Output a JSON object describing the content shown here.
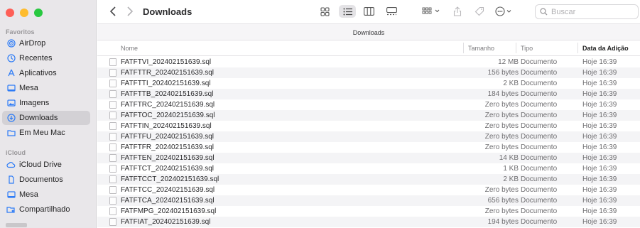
{
  "window": {
    "traffic_colors": {
      "close": "#fe5f57",
      "minimize": "#febc2e",
      "zoom": "#28c840"
    }
  },
  "sidebar": {
    "favorites_title": "Favoritos",
    "favorites": [
      {
        "label": "AirDrop",
        "icon": "airdrop-icon"
      },
      {
        "label": "Recentes",
        "icon": "clock-icon"
      },
      {
        "label": "Aplicativos",
        "icon": "apps-icon"
      },
      {
        "label": "Mesa",
        "icon": "desktop-icon"
      },
      {
        "label": "Imagens",
        "icon": "photo-icon"
      },
      {
        "label": "Downloads",
        "icon": "download-icon",
        "active": true
      },
      {
        "label": "Em Meu Mac",
        "icon": "folder-icon"
      }
    ],
    "icloud_title": "iCloud",
    "icloud": [
      {
        "label": "iCloud Drive",
        "icon": "cloud-icon"
      },
      {
        "label": "Documentos",
        "icon": "document-icon"
      },
      {
        "label": "Mesa",
        "icon": "desktop-icon"
      },
      {
        "label": "Compartilhado",
        "icon": "shared-folder-icon"
      }
    ]
  },
  "toolbar": {
    "title": "Downloads",
    "search_placeholder": "Buscar",
    "accent": "#2e7cf6"
  },
  "pathbar": {
    "label": "Downloads"
  },
  "columns": {
    "name": "Nome",
    "size": "Tamanho",
    "kind": "Tipo",
    "date": "Data da Adição"
  },
  "files": [
    {
      "name": "FATFTVI_202402151639.sql",
      "size": "12 MB",
      "kind": "Documento",
      "date": "Hoje 16:39"
    },
    {
      "name": "FATFTTR_202402151639.sql",
      "size": "156 bytes",
      "kind": "Documento",
      "date": "Hoje 16:39"
    },
    {
      "name": "FATFTTI_202402151639.sql",
      "size": "2 KB",
      "kind": "Documento",
      "date": "Hoje 16:39"
    },
    {
      "name": "FATFTTB_202402151639.sql",
      "size": "184 bytes",
      "kind": "Documento",
      "date": "Hoje 16:39"
    },
    {
      "name": "FATFTRC_202402151639.sql",
      "size": "Zero bytes",
      "kind": "Documento",
      "date": "Hoje 16:39"
    },
    {
      "name": "FATFTOC_202402151639.sql",
      "size": "Zero bytes",
      "kind": "Documento",
      "date": "Hoje 16:39"
    },
    {
      "name": "FATFTIN_202402151639.sql",
      "size": "Zero bytes",
      "kind": "Documento",
      "date": "Hoje 16:39"
    },
    {
      "name": "FATFTFU_202402151639.sql",
      "size": "Zero bytes",
      "kind": "Documento",
      "date": "Hoje 16:39"
    },
    {
      "name": "FATFTFR_202402151639.sql",
      "size": "Zero bytes",
      "kind": "Documento",
      "date": "Hoje 16:39"
    },
    {
      "name": "FATFTEN_202402151639.sql",
      "size": "14 KB",
      "kind": "Documento",
      "date": "Hoje 16:39"
    },
    {
      "name": "FATFTCT_202402151639.sql",
      "size": "1 KB",
      "kind": "Documento",
      "date": "Hoje 16:39"
    },
    {
      "name": "FATFTCCT_202402151639.sql",
      "size": "2 KB",
      "kind": "Documento",
      "date": "Hoje 16:39"
    },
    {
      "name": "FATFTCC_202402151639.sql",
      "size": "Zero bytes",
      "kind": "Documento",
      "date": "Hoje 16:39"
    },
    {
      "name": "FATFTCA_202402151639.sql",
      "size": "656 bytes",
      "kind": "Documento",
      "date": "Hoje 16:39"
    },
    {
      "name": "FATFMPG_202402151639.sql",
      "size": "Zero bytes",
      "kind": "Documento",
      "date": "Hoje 16:39"
    },
    {
      "name": "FATFIAT_202402151639.sql",
      "size": "194 bytes",
      "kind": "Documento",
      "date": "Hoje 16:39"
    }
  ]
}
